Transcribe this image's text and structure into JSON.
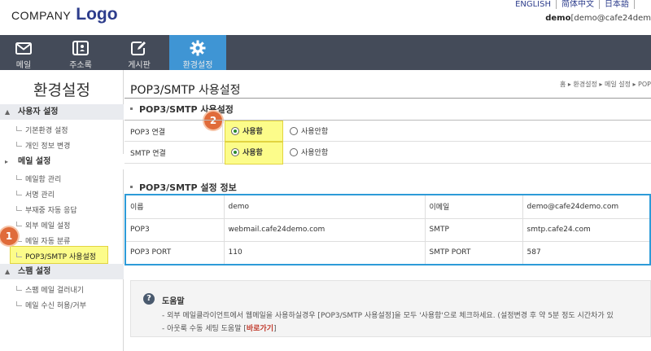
{
  "logo": {
    "company": "COMPANY",
    "mark": "Logo"
  },
  "languages": [
    "ENGLISH",
    "简体中文",
    "日本語",
    ""
  ],
  "user": {
    "id": "demo",
    "email": "[demo@cafe24dem"
  },
  "nav": [
    {
      "label": "메일",
      "icon": "mail-icon"
    },
    {
      "label": "주소록",
      "icon": "addressbook-icon"
    },
    {
      "label": "게시판",
      "icon": "board-edit-icon"
    },
    {
      "label": "환경설정",
      "icon": "gear-icon"
    }
  ],
  "sidebar": {
    "title": "환경설정",
    "sections": [
      {
        "label": "사용자 설정",
        "items": [
          "기본환경 설정",
          "개인 정보 변경"
        ]
      },
      {
        "label": "메일 설정",
        "items": [
          "메일함 관리",
          "서명 관리",
          "부재중 자동 응답",
          "외부 메일 설정",
          "메일 자동 분류",
          "POP3/SMTP 사용설정"
        ]
      },
      {
        "label": "스팸 설정",
        "items": [
          "스팸 메일 걸러내기",
          "메일 수신 허용/거부"
        ]
      }
    ]
  },
  "page": {
    "title": "POP3/SMTP 사용설정",
    "breadcrumb": "홈 ▸ 환경설정 ▸ 메일 설정 ▸ POP"
  },
  "form": {
    "heading": "POP3/SMTP 사용설정",
    "rows": [
      {
        "label": "POP3 연결",
        "on": "사용함",
        "off": "사용안함"
      },
      {
        "label": "SMTP 연결",
        "on": "사용함",
        "off": "사용안함"
      }
    ]
  },
  "info": {
    "heading": "POP3/SMTP 설정 정보",
    "rows": [
      [
        "이름",
        "demo",
        "이메일",
        "demo@cafe24demo.com"
      ],
      [
        "POP3",
        "webmail.cafe24demo.com",
        "SMTP",
        "smtp.cafe24.com"
      ],
      [
        "POP3 PORT",
        "110",
        "SMTP PORT",
        "587"
      ]
    ]
  },
  "help": {
    "title": "도움말",
    "line1": "- 외부 메일클라이언트에서 웹메일을 사용하실경우 [POP3/SMTP 사용설정]을 모두 '사용함'으로 체크하세요. (설정변경 후 약 5분 정도 시간차가 있",
    "line2_prefix": "- 아웃룩 수동 세팅 도움말 [",
    "line2_link": "바로가기",
    "line2_suffix": "]"
  },
  "badges": [
    "1",
    "2"
  ],
  "colors": {
    "nav_bg": "#444b59",
    "nav_active": "#3f95d4",
    "highlight": "#fcfc8a",
    "info_border": "#2d9bd8",
    "badge": "#e06b3a"
  }
}
